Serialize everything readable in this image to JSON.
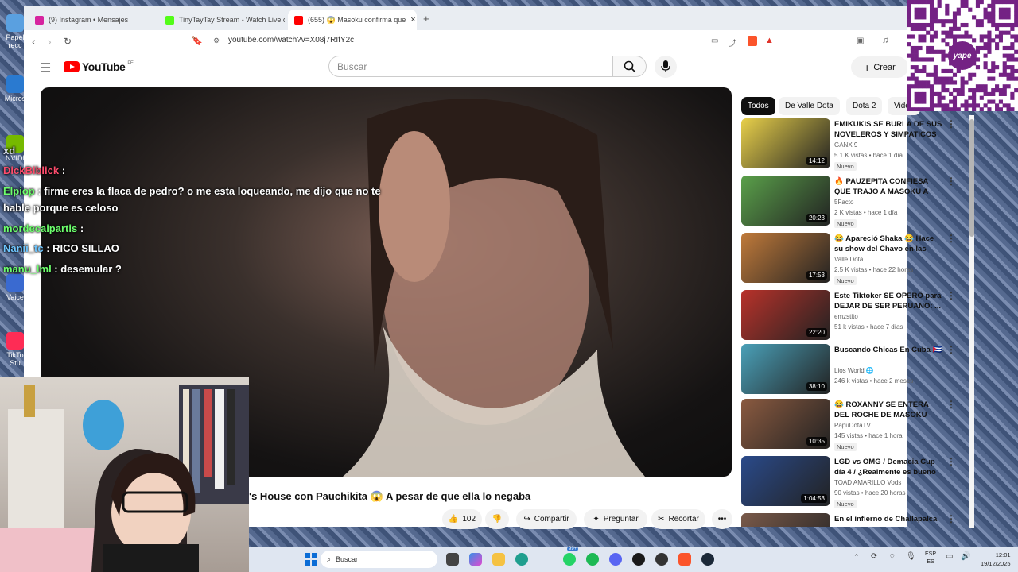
{
  "browser": {
    "tabs": [
      {
        "label": "(9) Instagram • Mensajes",
        "color": "#d6249f"
      },
      {
        "label": "TinyTayTay Stream - Watch Live on K",
        "color": "#53fc18"
      },
      {
        "label": "(655) 😱 Masoku confirma que",
        "color": "#ff0000"
      }
    ],
    "new_tab": "+",
    "url": "youtube.com/watch?v=X08j7RIfY2c"
  },
  "youtube": {
    "logo_text": "YouTube",
    "region": "PE",
    "search_placeholder": "Buscar",
    "create_label": "Crear"
  },
  "chat": [
    {
      "user": "xd",
      "msg": "",
      "color": "#cfd8e3"
    },
    {
      "user": "DickBiblick",
      "msg": " : ",
      "color": "#ff4d6d"
    },
    {
      "user": "Elpiop",
      "msg": " : firme eres la flaca de pedro? o me esta loqueando, me dijo que no te",
      "color": "#6dff6d"
    },
    {
      "user": "",
      "msg": "hable porque es celoso",
      "color": "#ffffff"
    },
    {
      "user": "mordecaipartis",
      "msg": " : ",
      "color": "#6dff6d"
    },
    {
      "user": "Nanii_tc",
      "msg": " : RICO SILLAO",
      "color": "#6ec6ff"
    },
    {
      "user": "manu_lml",
      "msg": " : desemular ?",
      "color": "#6dff6d"
    }
  ],
  "video": {
    "title": "'s House con Pauchikita 😱 A pesar de que ella lo negaba",
    "likes": "102",
    "share": "Compartir",
    "ask": "Preguntar",
    "clip": "Recortar",
    "more": "•••"
  },
  "chips": [
    "Todos",
    "De Valle Dota",
    "Dota 2",
    "Video"
  ],
  "recommendations": [
    {
      "title": "EMIKUKIS SE BURLA DE SUS NOVELEROS Y SIMPATICOS",
      "channel": "GANX 9",
      "meta": "5.1 K vistas • hace 1 día",
      "badge": "Nuevo",
      "duration": "14:12",
      "thumb": "#e8d04a"
    },
    {
      "title": "🔥 PAUZEPITA CONFIESA QUE TRAJO A MASOKU A KCHAR ...",
      "channel": "5Facto",
      "meta": "2 K vistas • hace 1 día",
      "badge": "Nuevo",
      "duration": "20:23",
      "thumb": "#5aa04a"
    },
    {
      "title": "😂 Apareció Shaka 😂 Hace su show del Chavo en las favelas,...",
      "channel": "Valle Dota",
      "meta": "2.5 K vistas • hace 22 horas",
      "badge": "Nuevo",
      "duration": "17:53",
      "thumb": "#c07a3a"
    },
    {
      "title": "Este Tiktoker SE OPERÓ para DEJAR DE SER PERUANO: ...",
      "channel": "emzstito",
      "meta": "51 k vistas • hace 7 días",
      "badge": "",
      "duration": "22:20",
      "thumb": "#b8322a"
    },
    {
      "title": "Buscando Chicas En Cuba 🇨🇺",
      "channel": "Lios World 🌐",
      "meta": "246 k vistas • hace 2 meses",
      "badge": "",
      "duration": "38:10",
      "thumb": "#4aa0b8"
    },
    {
      "title": "😂 ROXANNY SE ENTERA DEL ROCHE DE MASOKU INSINUA ...",
      "channel": "PapuDotaTV",
      "meta": "145 vistas • hace 1 hora",
      "badge": "Nuevo",
      "duration": "10:35",
      "thumb": "#8a5a40"
    },
    {
      "title": "LGD vs OMG / Demacia Cup día 4 / ¿Realmente es bueno OMG?",
      "channel": "TOAD AMARILLO Vods",
      "meta": "90 vistas • hace 20 horas",
      "badge": "Nuevo",
      "duration": "1:04:53",
      "thumb": "#2a4a8a"
    },
    {
      "title": "En el infierno de Challapalca",
      "channel": "",
      "meta": "",
      "badge": "",
      "duration": "",
      "thumb": "#7a5a4a"
    }
  ],
  "desktop_icons": [
    {
      "label": "Papel recc",
      "color": "#5aa0e0"
    },
    {
      "label": "Micros",
      "color": "#2a7ad0"
    },
    {
      "label": "NVIDI",
      "color": "#76b900"
    },
    {
      "label": "Vaice",
      "color": "#3a6ad0"
    },
    {
      "label": "TikTo Stu",
      "color": "#fe2c55"
    }
  ],
  "taskbar": {
    "search_label": "Buscar",
    "badge": "99+",
    "lang": "ESP",
    "lang_sub": "ES",
    "time": "12:01",
    "date": "19/12/2025"
  },
  "qr": {
    "brand": "yape"
  }
}
